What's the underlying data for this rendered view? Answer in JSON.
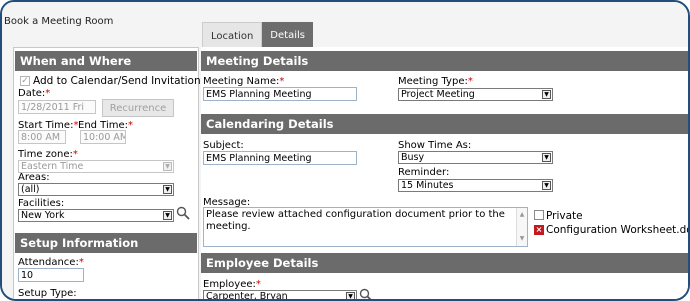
{
  "page": {
    "title": "Book a Meeting Room"
  },
  "tabs": [
    {
      "label": "Location",
      "active": false
    },
    {
      "label": "Details",
      "active": true
    }
  ],
  "colors": {
    "section_header": "#6b6b6b",
    "frame_border": "#1f4f7a",
    "required": "#cc0000",
    "attachment_icon": "#c2191f"
  },
  "when_where": {
    "header": "When and Where",
    "add_to_calendar": {
      "label": "Add to Calendar/Send Invitations",
      "checked": true
    },
    "date": {
      "label": "Date:",
      "required_mark": "*",
      "value": "1/28/2011 Fri",
      "recurrence_label": "Recurrence"
    },
    "start_time": {
      "label": "Start Time:",
      "required_mark": "*",
      "value": "8:00 AM"
    },
    "end_time": {
      "label": "End Time:",
      "required_mark": "*",
      "value": "10:00 AM"
    },
    "time_zone": {
      "label": "Time zone:",
      "required_mark": "*",
      "value": "Eastern Time"
    },
    "areas": {
      "label": "Areas:",
      "value": "(all)"
    },
    "facilities": {
      "label": "Facilities:",
      "value": "New York"
    }
  },
  "setup": {
    "header": "Setup Information",
    "attendance": {
      "label": "Attendance:",
      "required_mark": "*",
      "value": "10"
    },
    "setup_type": {
      "label": "Setup Type:"
    }
  },
  "meeting_details": {
    "header": "Meeting Details",
    "meeting_name": {
      "label": "Meeting Name:",
      "required_mark": "*",
      "value": "EMS Planning Meeting"
    },
    "meeting_type": {
      "label": "Meeting Type:",
      "required_mark": "*",
      "value": "Project Meeting"
    }
  },
  "calendaring": {
    "header": "Calendaring Details",
    "subject": {
      "label": "Subject:",
      "value": "EMS Planning Meeting"
    },
    "show_time_as": {
      "label": "Show Time As:",
      "value": "Busy"
    },
    "reminder": {
      "label": "Reminder:",
      "value": "15 Minutes"
    },
    "message": {
      "label": "Message:",
      "value": "Please review attached configuration document prior to the meeting."
    },
    "private": {
      "label": "Private",
      "checked": false
    },
    "attachment": {
      "icon": "remove-attachment-icon",
      "filename": "Configuration Worksheet.docx"
    }
  },
  "employee": {
    "header": "Employee Details",
    "employee_field": {
      "label": "Employee:",
      "required_mark": "*",
      "value": "Carpenter, Bryan"
    }
  }
}
